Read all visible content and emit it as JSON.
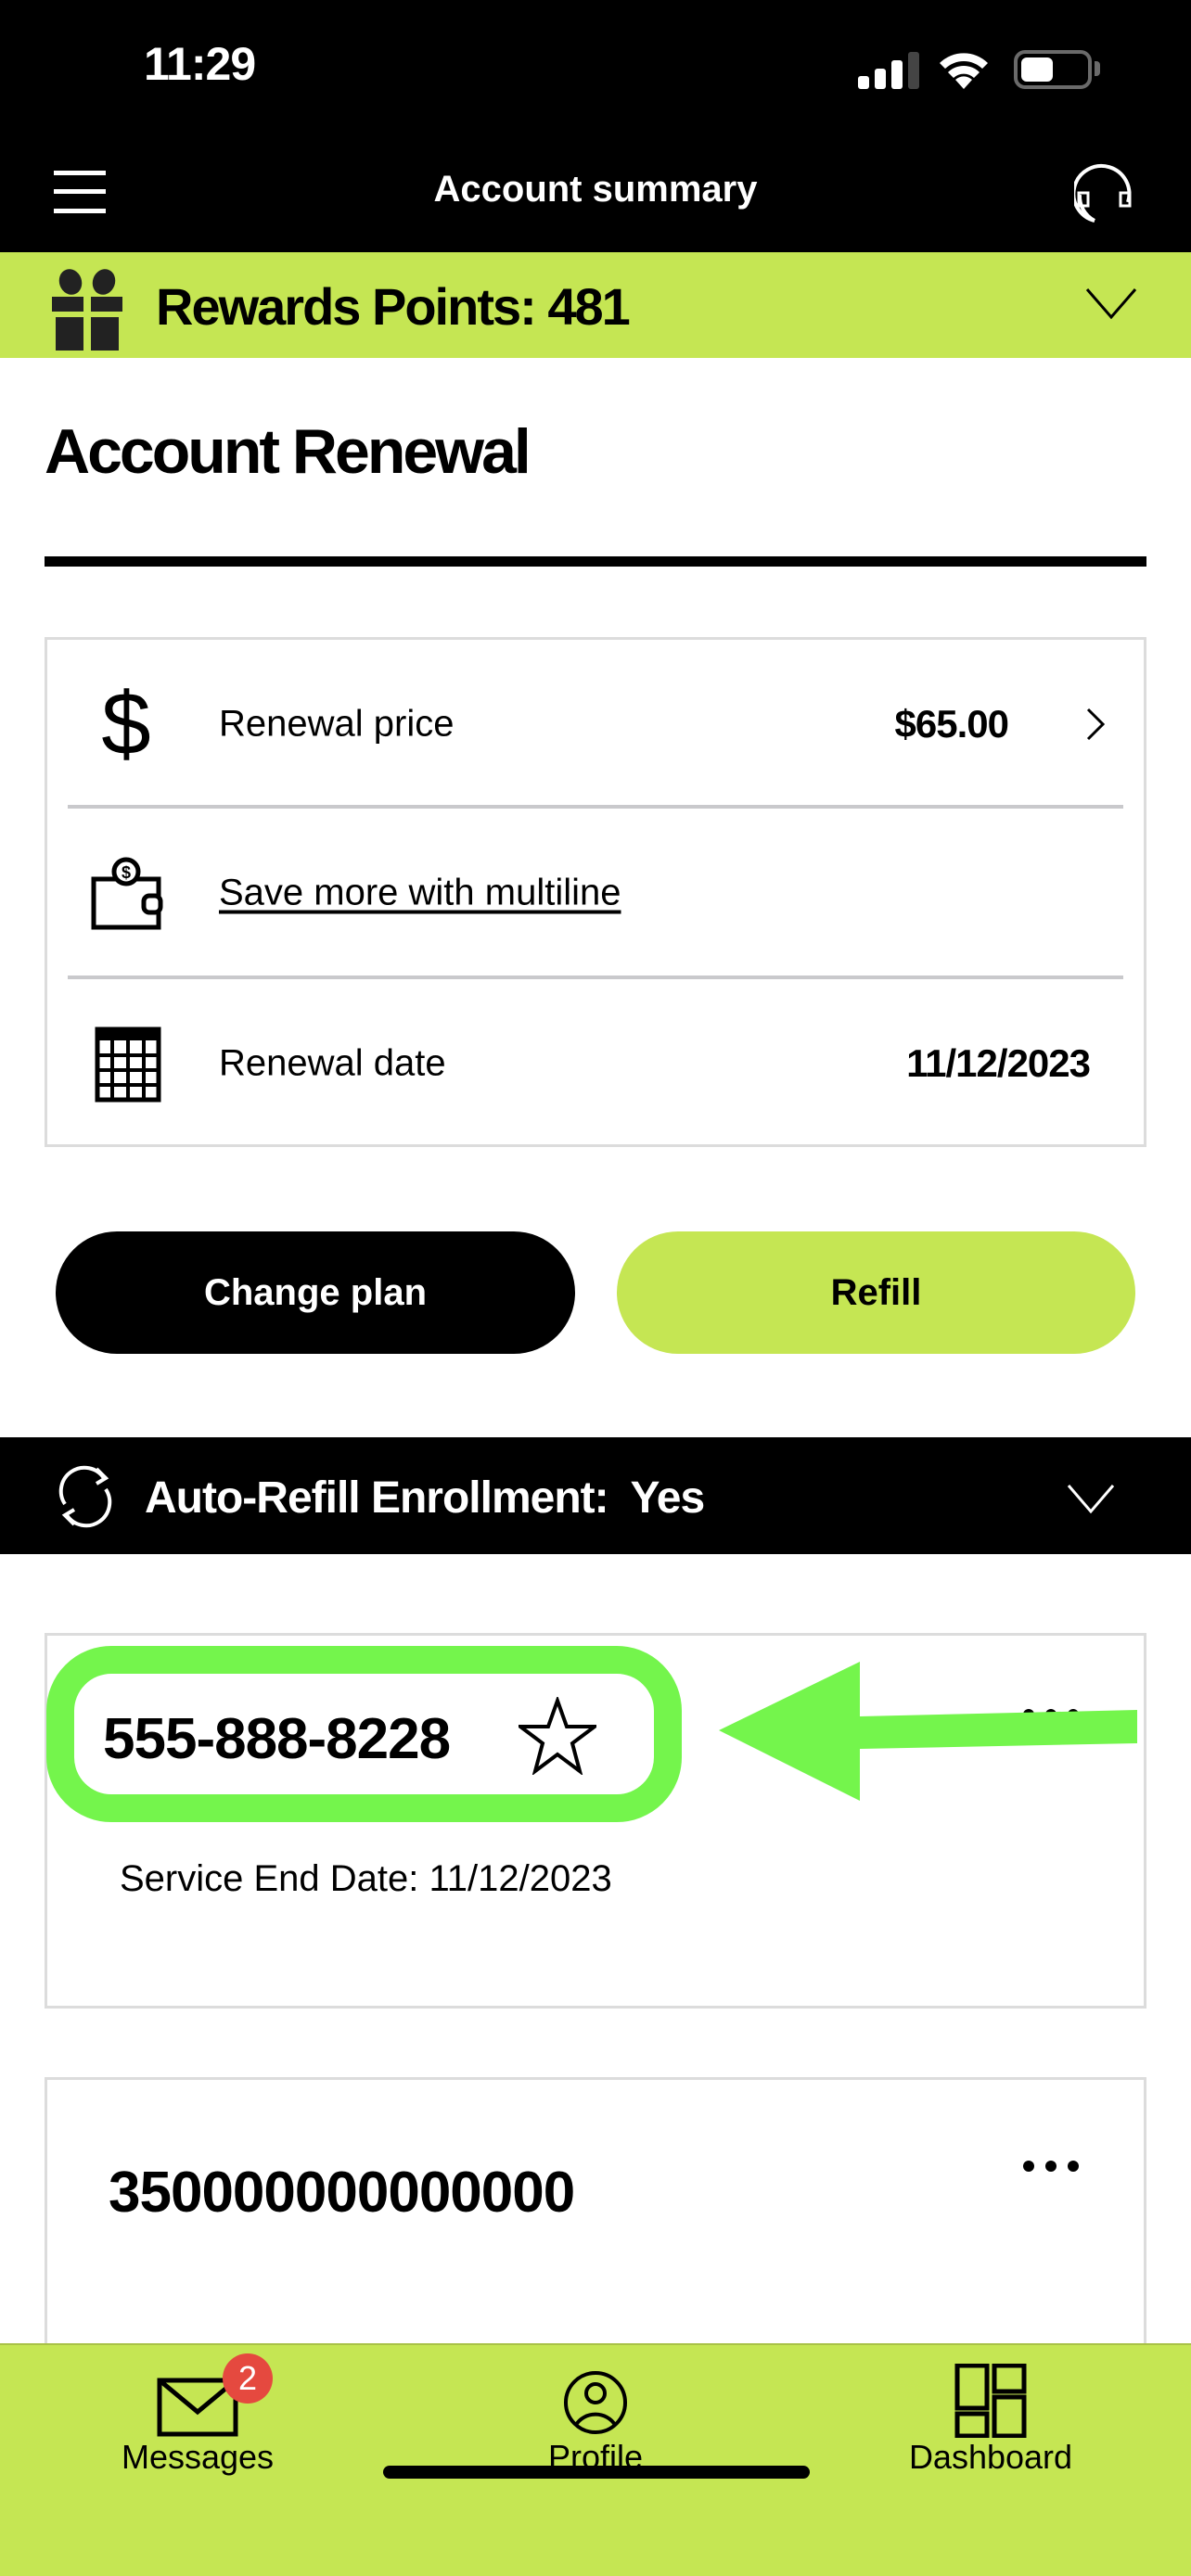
{
  "status_bar": {
    "time": "11:29",
    "signal_bars_active": 3,
    "signal_bars_total": 4,
    "battery_percent": 50
  },
  "header": {
    "title": "Account summary",
    "menu_icon": "hamburger-menu-icon",
    "support_icon": "headset-icon"
  },
  "rewards": {
    "label": "Rewards Points: 481",
    "icon": "gift-icon"
  },
  "page": {
    "title": "Account Renewal"
  },
  "renewal_card": {
    "rows": [
      {
        "icon": "dollar-icon",
        "label": "Renewal price",
        "value": "$65.00",
        "has_chevron": true
      },
      {
        "icon": "wallet-icon",
        "label": "Save more with multiline",
        "link": true
      },
      {
        "icon": "calendar-icon",
        "label": "Renewal date",
        "value": "11/12/2023"
      }
    ]
  },
  "buttons": {
    "change_plan": "Change plan",
    "refill": "Refill"
  },
  "auto_refill": {
    "label": "Auto-Refill Enrollment:  Yes"
  },
  "lines": [
    {
      "number": "555-888-8228",
      "favorite_icon": "star-outline-icon",
      "service_end": "Service End Date: 11/12/2023"
    },
    {
      "number": "350000000000000"
    }
  ],
  "tab_bar": {
    "tabs": [
      {
        "label": "Messages",
        "icon": "envelope-icon",
        "badge": "2"
      },
      {
        "label": "Profile",
        "icon": "profile-icon"
      },
      {
        "label": "Dashboard",
        "icon": "dashboard-icon"
      }
    ]
  },
  "colors": {
    "brand_lime": "#c5e653",
    "annotation_green": "#74f54c",
    "badge_red": "#e5493f",
    "black": "#000000"
  }
}
